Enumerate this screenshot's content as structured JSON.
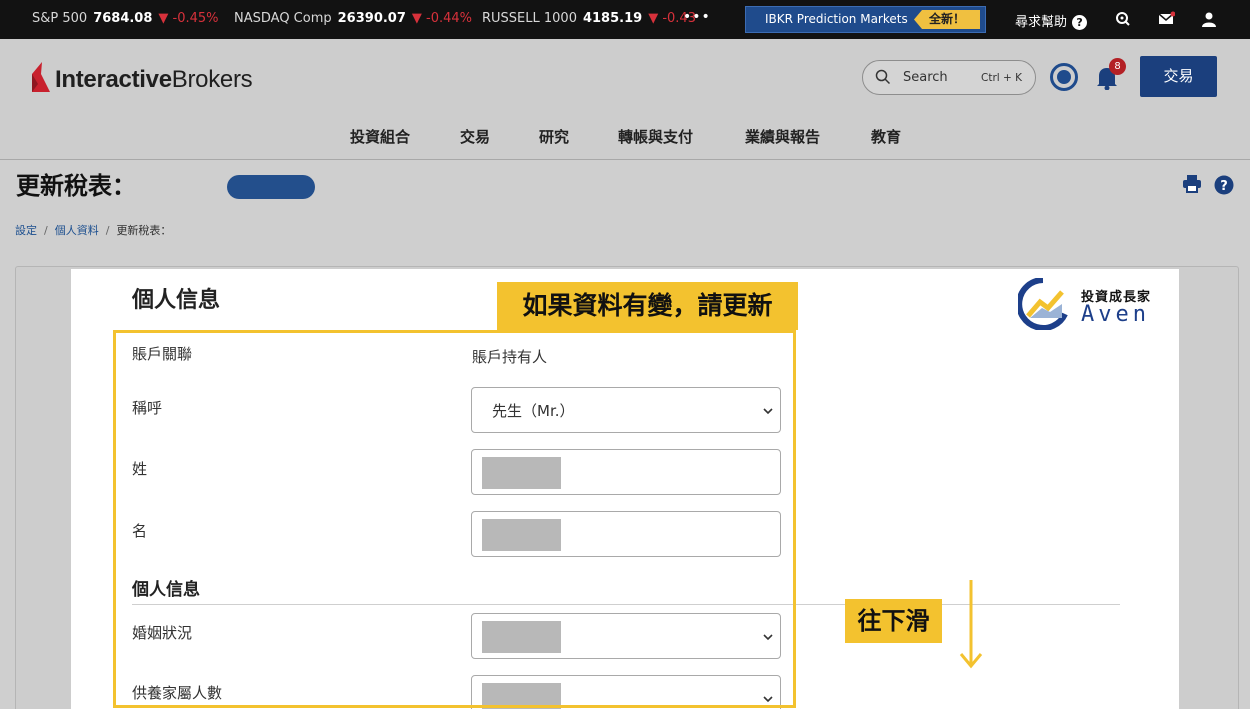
{
  "ticker": {
    "items": [
      {
        "name": "S&P 500",
        "value": "7684.08",
        "change": "-0.45%"
      },
      {
        "name": "NASDAQ Comp",
        "value": "26390.07",
        "change": "-0.44%"
      },
      {
        "name": "RUSSELL 1000",
        "value": "4185.19",
        "change": "-0.43"
      }
    ],
    "more": "•••",
    "prediction_markets": "IBKR Prediction Markets",
    "new_badge": "全新！",
    "help": "尋求幫助",
    "help_q": "?"
  },
  "header": {
    "logo_interactive": "Interactive",
    "logo_brokers": "Brokers",
    "search_label": "Search",
    "search_shortcut": "Ctrl + K",
    "notification_count": "8",
    "trade_button": "交易",
    "nav": [
      "投資組合",
      "交易",
      "研究",
      "轉帳與支付",
      "業績與報告",
      "教育"
    ]
  },
  "page": {
    "title": "更新稅表：",
    "breadcrumb": [
      "設定",
      "個人資料",
      "更新稅表："
    ]
  },
  "form": {
    "section_title": "個人信息",
    "account_link_label": "賬戶關聯",
    "account_link_value": "賬戶持有人",
    "salutation_label": "稱呼",
    "salutation_value": "先生（Mr.）",
    "last_name_label": "姓",
    "first_name_label": "名",
    "subsection_title": "個人信息",
    "marital_label": "婚姻狀況",
    "dependents_label": "供養家屬人數"
  },
  "annotations": {
    "update_note": "如果資料有變，請更新",
    "scroll_note": "往下滑",
    "brand_zh": "投資成長家",
    "brand_en": "Aven"
  },
  "colors": {
    "highlight": "#f3c22f",
    "brand_blue": "#1b3f7d",
    "ticker_down": "#d7313b"
  }
}
